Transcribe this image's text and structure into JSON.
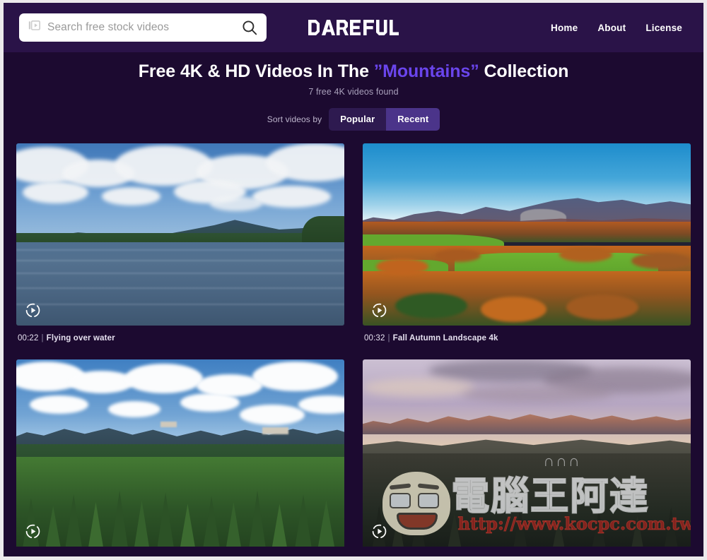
{
  "colors": {
    "page_bg": "#1c0a30",
    "header_bg": "#2a1348",
    "accent_purple": "#6a45ec",
    "sort_active": "#4b348a",
    "sort_inactive": "#2e1a50"
  },
  "header": {
    "search": {
      "placeholder": "Search free stock videos",
      "value": "",
      "left_icon": "video-collection-icon",
      "submit_icon": "search-icon"
    },
    "logo": "DAREFUL",
    "nav": [
      {
        "label": "Home"
      },
      {
        "label": "About"
      },
      {
        "label": "License"
      }
    ]
  },
  "title": {
    "prefix": "Free 4K & HD Videos In The ",
    "highlight": "”Mountains”",
    "suffix": " Collection",
    "result_count": "7 free 4K videos found"
  },
  "sort": {
    "label": "Sort videos by",
    "options": [
      {
        "label": "Popular",
        "active": false
      },
      {
        "label": "Recent",
        "active": true
      }
    ]
  },
  "videos": [
    {
      "duration": "00:22",
      "separator": "|",
      "name": "Flying over water",
      "play_icon": "play-circle-icon"
    },
    {
      "duration": "00:32",
      "separator": "|",
      "name": "Fall Autumn Landscape 4k",
      "play_icon": "play-circle-icon"
    },
    {
      "duration": "",
      "separator": "",
      "name": "",
      "play_icon": "play-circle-icon"
    },
    {
      "duration": "",
      "separator": "",
      "name": "",
      "play_icon": "play-circle-icon"
    }
  ],
  "watermark": {
    "text": "電腦王阿達",
    "url": "http://www.kocpc.com.tw",
    "crown": "∩∩∩"
  }
}
